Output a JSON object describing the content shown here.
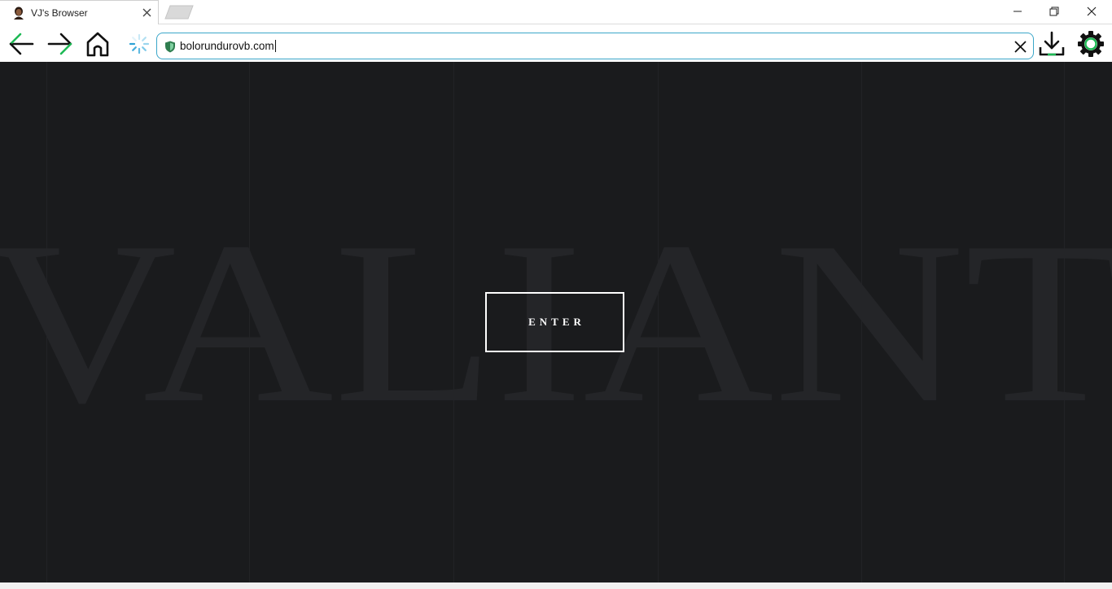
{
  "tab": {
    "title": "VJ's Browser"
  },
  "address": {
    "url": "bolorundurovb.com"
  },
  "page": {
    "watermark_text": "VALIANT",
    "enter_label": "ENTER"
  },
  "colors": {
    "accent_green": "#1db954",
    "address_border": "#3aa6c9",
    "page_background": "#1a1b1d",
    "watermark": "#242528"
  },
  "icons": {
    "back": "arrow-left-icon",
    "forward": "arrow-right-icon",
    "home": "home-icon",
    "loading": "spinner-icon",
    "secure": "shield-icon",
    "clear": "close-icon",
    "download": "download-icon",
    "settings": "gear-icon"
  }
}
